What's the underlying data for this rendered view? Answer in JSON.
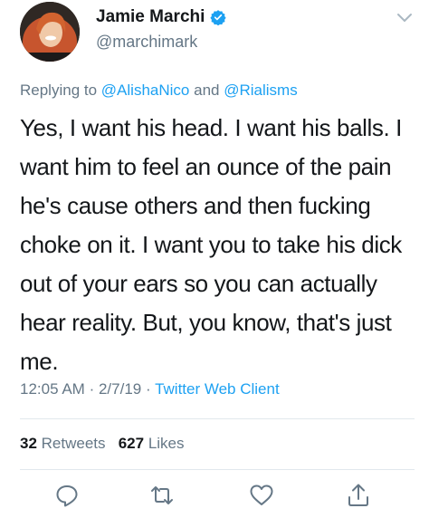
{
  "tweet": {
    "author": {
      "display_name": "Jamie Marchi",
      "handle": "@marchimark"
    },
    "replying_to": {
      "prefix": "Replying to",
      "first": "@AlishaNico",
      "connector": "and",
      "second": "@Rialisms"
    },
    "text": "Yes, I want his head. I want his balls. I\nwant him to feel an ounce of the pain\nhe's cause others and then fucking\nchoke on it. I want you to take his dick\nout of your ears so you can actually\nhear reality. But, you know, that's just\nme.",
    "time": "12:05 AM",
    "separator": "·",
    "date": "2/7/19",
    "client": "Twitter Web Client",
    "retweets_count": "32",
    "retweets_label": "Retweets",
    "likes_count": "627",
    "likes_label": "Likes"
  },
  "icons": {
    "verified": "verified-badge-icon",
    "menu": "chevron-down-icon",
    "reply": "reply-icon",
    "retweet": "retweet-icon",
    "like": "heart-icon",
    "share": "share-icon"
  },
  "colors": {
    "link": "#1da1f2",
    "secondary_text": "#657786",
    "primary_text": "#14171a",
    "divider": "#e1e8ed"
  }
}
